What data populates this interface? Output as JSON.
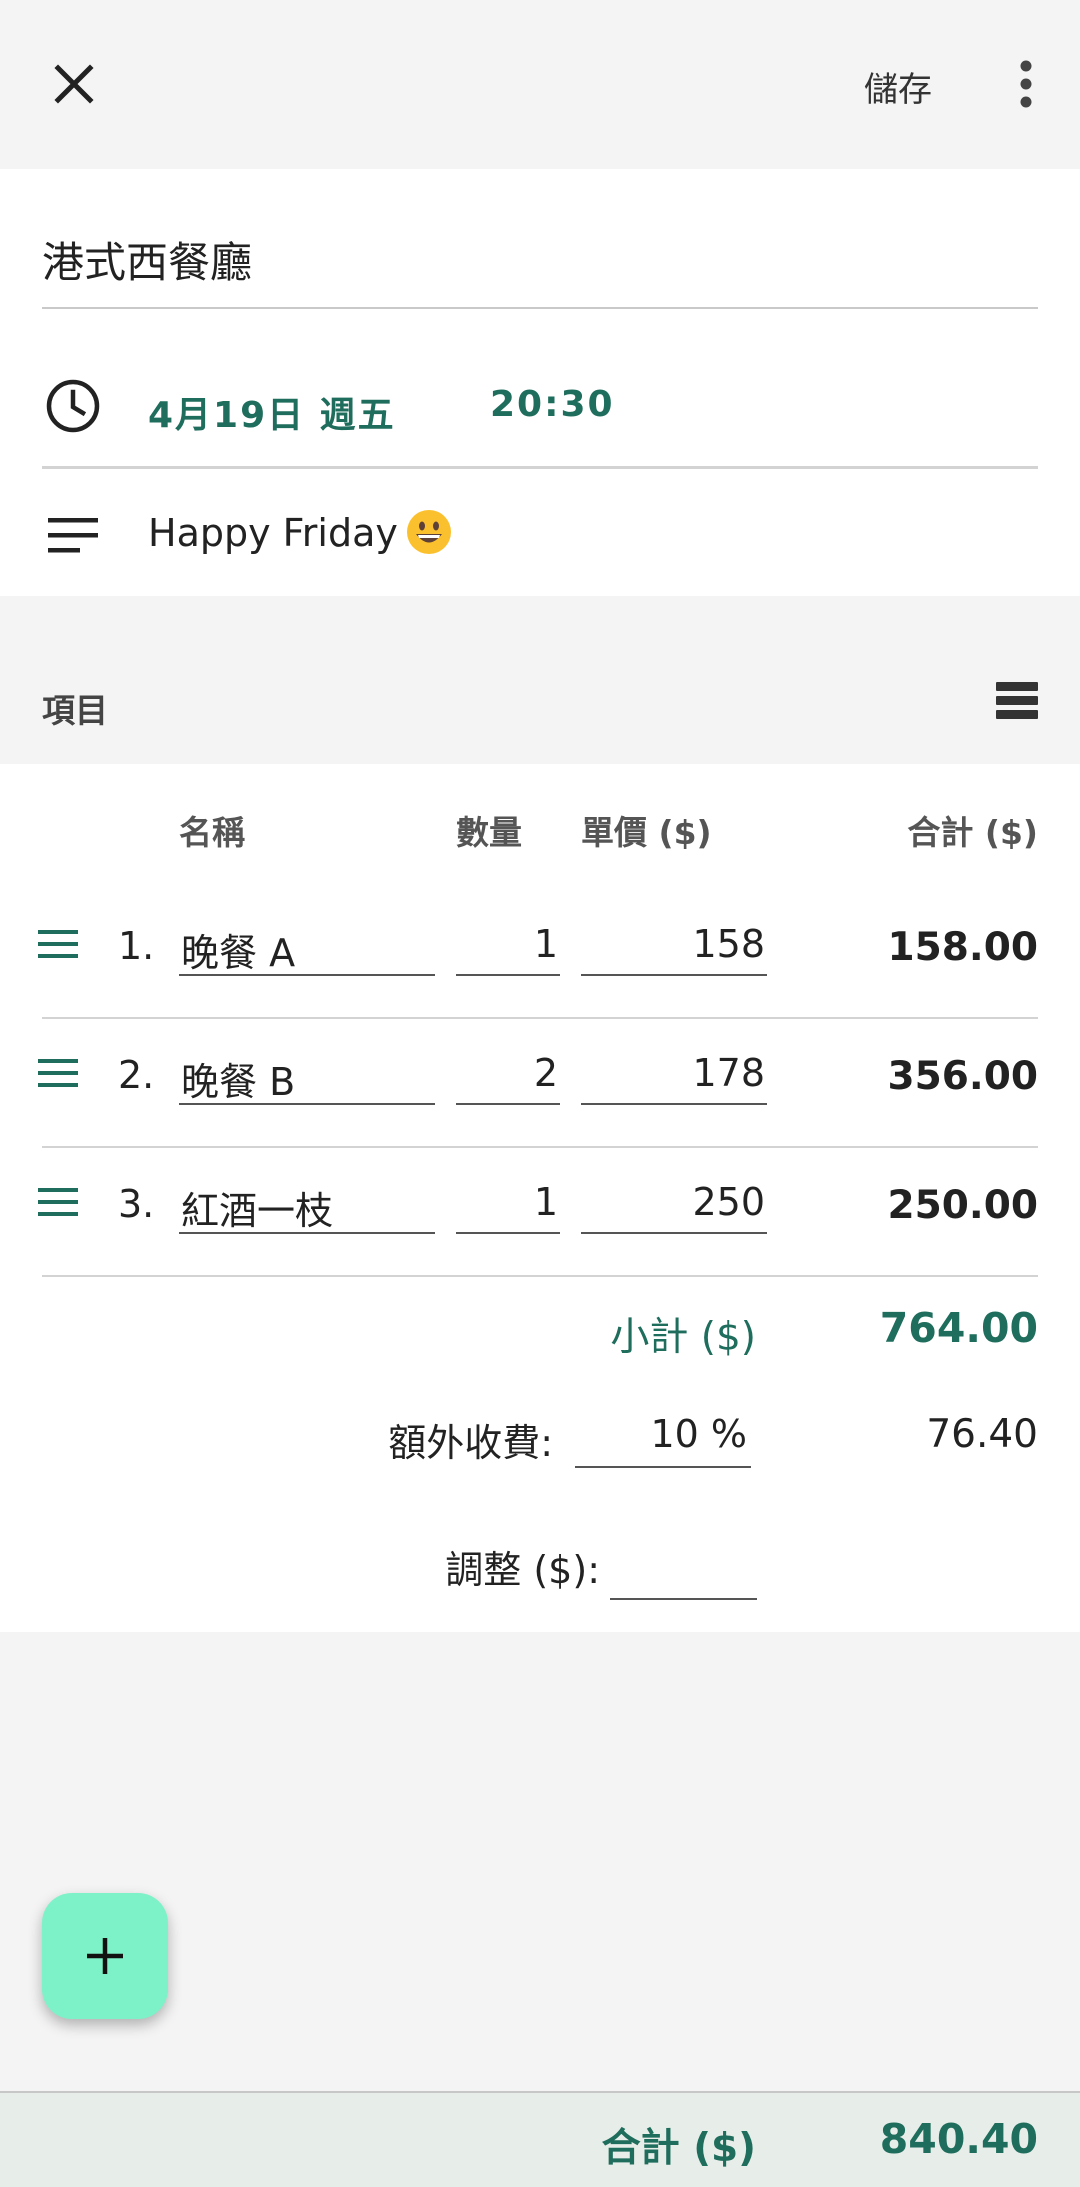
{
  "toolbar": {
    "close_icon": "close-icon",
    "save_label": "儲存",
    "more_icon": "more-vert-icon"
  },
  "bill": {
    "title": "港式西餐廳",
    "date": "4月19日 週五",
    "time": "20:30",
    "notes": "Happy Friday",
    "notes_emoji": "grinning-face-emoji"
  },
  "items_section": {
    "label": "項目",
    "columns": {
      "name": "名稱",
      "qty": "數量",
      "price": "單價 ($)",
      "total": "合計 ($)"
    },
    "items": [
      {
        "num": "1.",
        "name": "晚餐 A",
        "qty": "1",
        "price": "158",
        "total": "158.00"
      },
      {
        "num": "2.",
        "name": "晚餐 B",
        "qty": "2",
        "price": "178",
        "total": "356.00"
      },
      {
        "num": "3.",
        "name": "紅酒一枝",
        "qty": "1",
        "price": "250",
        "total": "250.00"
      }
    ]
  },
  "summary": {
    "subtotal_label": "小計 ($)",
    "subtotal_value": "764.00",
    "extra_label": "額外收費:",
    "extra_percent": "10 %",
    "extra_value": "76.40",
    "adjust_label": "調整 ($):",
    "adjust_value": ""
  },
  "footer": {
    "total_label": "合計 ($)",
    "total_value": "840.40"
  },
  "colors": {
    "accent": "#1f6d5c",
    "fab": "#7df2c8",
    "total_bar": "#e7ede8"
  }
}
